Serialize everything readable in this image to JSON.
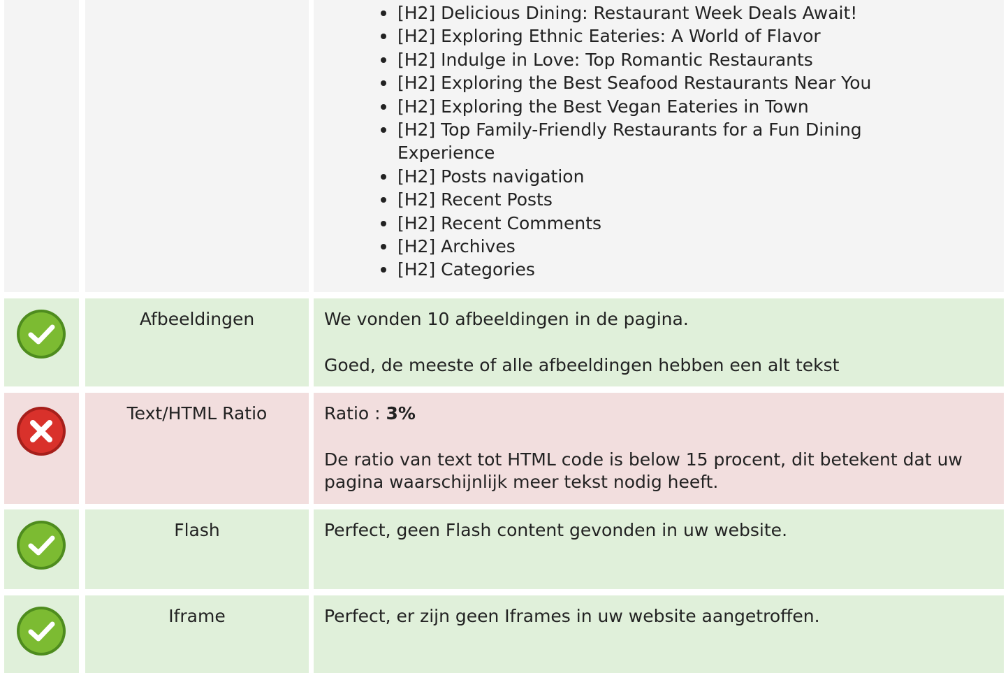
{
  "headings": {
    "items": [
      "[H2] Delicious Dining: Restaurant Week Deals Await!",
      "[H2] Exploring Ethnic Eateries: A World of Flavor",
      "[H2] Indulge in Love: Top Romantic Restaurants",
      "[H2] Exploring the Best Seafood Restaurants Near You",
      "[H2] Exploring the Best Vegan Eateries in Town",
      "[H2] Top Family-Friendly Restaurants for a Fun Dining Experience",
      "[H2] Posts navigation",
      "[H2] Recent Posts",
      "[H2] Recent Comments",
      "[H2] Archives",
      "[H2] Categories"
    ]
  },
  "checks": {
    "images": {
      "status": "pass",
      "label": "Afbeeldingen",
      "line1": "We vonden 10 afbeeldingen in de pagina.",
      "line2": "Goed, de meeste of alle afbeeldingen hebben een alt tekst"
    },
    "ratio": {
      "status": "fail",
      "label": "Text/HTML Ratio",
      "prefix": "Ratio : ",
      "value": "3%",
      "line2": "De ratio van text tot HTML code is below 15 procent, dit betekent dat uw pagina waarschijnlijk meer tekst nodig heeft."
    },
    "flash": {
      "status": "pass",
      "label": "Flash",
      "line1": "Perfect, geen Flash content gevonden in uw website."
    },
    "iframe": {
      "status": "pass",
      "label": "Iframe",
      "line1": "Perfect, er zijn geen Iframes in uw website aangetroffen."
    }
  },
  "colors": {
    "pass_bg": "#e0f0da",
    "fail_bg": "#f2dede",
    "neutral_bg": "#f4f4f4",
    "pass_icon": "#7cbb32",
    "fail_icon": "#d9312b"
  },
  "icons": {
    "pass": "check-circle-icon",
    "fail": "x-circle-icon"
  }
}
